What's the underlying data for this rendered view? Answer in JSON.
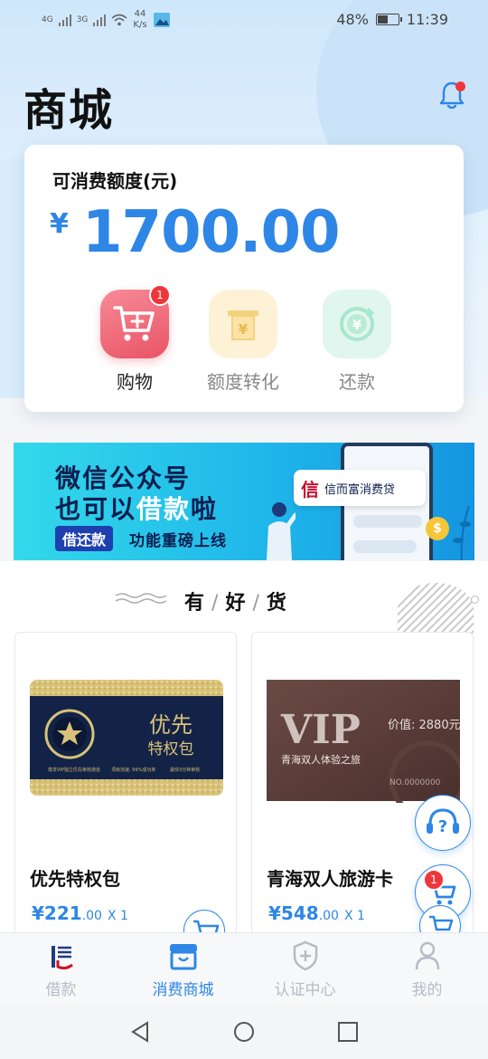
{
  "status_bar": {
    "net1": "4G",
    "net2": "3G",
    "speed_value": "44",
    "speed_unit": "K/s",
    "battery": "48%",
    "battery_level": 0.48,
    "time": "11:39"
  },
  "header": {
    "title": "商城"
  },
  "credit": {
    "label": "可消费额度(元)",
    "currency": "¥",
    "amount": "1700.00",
    "accent_color": "#2e86e6"
  },
  "actions": [
    {
      "label": "购物",
      "badge": "1",
      "icon": "cart-plus-icon"
    },
    {
      "label": "额度转化",
      "icon": "atm-yen-icon"
    },
    {
      "label": "还款",
      "icon": "refresh-yen-icon"
    }
  ],
  "banner": {
    "line1": "微信公众号",
    "line2_prefix": "也可以",
    "line2_highlight": "借款",
    "line2_suffix": "啦",
    "pill": "借还款",
    "line3": "功能重磅上线",
    "chat_logo": "信",
    "chat_text": "信而富消费贷",
    "coin": "$"
  },
  "section": {
    "c1": "有",
    "sep": "/",
    "c2": "好",
    "c3": "货"
  },
  "products": [
    {
      "name": "优先特权包",
      "price_main": "¥221",
      "price_dec": ".00",
      "qty": "X 1",
      "card_title": "优先",
      "card_sub": "特权包",
      "card_fine1": "尊享VIP独立优先审核通道",
      "card_fine2": "顶级加速, 99%成功率",
      "card_fine3": "最快3分钟审核"
    },
    {
      "name": "青海双人旅游卡",
      "price_main": "¥548",
      "price_dec": ".00",
      "qty": "X 1",
      "card_vip": "VIP",
      "card_value": "价值: 2880元",
      "card_sub": "青海双人体验之旅",
      "card_no": "NO.0000000"
    }
  ],
  "float": {
    "cart_badge": "1"
  },
  "tabs": [
    {
      "label": "借款",
      "icon": "xin-logo-icon",
      "active": false
    },
    {
      "label": "消费商城",
      "icon": "store-icon",
      "active": true
    },
    {
      "label": "认证中心",
      "icon": "shield-plus-icon",
      "active": false
    },
    {
      "label": "我的",
      "icon": "user-icon",
      "active": false
    }
  ]
}
